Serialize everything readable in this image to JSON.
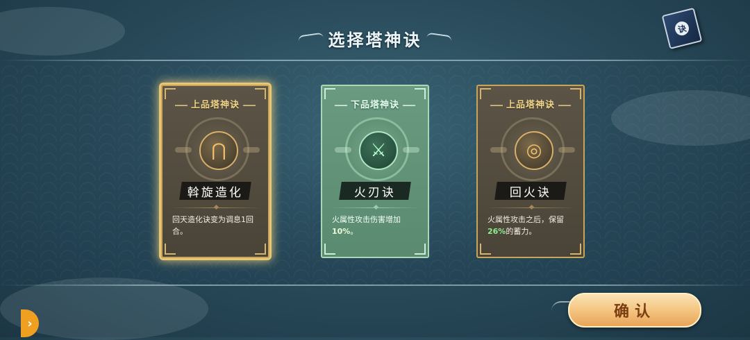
{
  "header": {
    "title": "选择塔神诀"
  },
  "book_button": {
    "glyph": "诀",
    "icon": "skill-book-icon"
  },
  "cards": [
    {
      "grade": "上品塔神诀",
      "name": "斡旋造化",
      "desc": "回天造化诀变为调息1回合。",
      "highlight": "",
      "desc_after": "",
      "icon": "rune-arch-icon",
      "glyph": "⋂",
      "theme": "brown",
      "selected": true
    },
    {
      "grade": "下品塔神诀",
      "name": "火刃诀",
      "desc": "火属性攻击伤害增加",
      "highlight": "10%",
      "desc_after": "。",
      "icon": "blade-icon",
      "glyph": "⚔",
      "theme": "green",
      "selected": false
    },
    {
      "grade": "上品塔神诀",
      "name": "回火诀",
      "desc": "火属性攻击之后，保留",
      "highlight": "26%",
      "desc_after": "的蓄力。",
      "icon": "spiral-flame-icon",
      "glyph": "◎",
      "theme": "brown",
      "selected": false
    }
  ],
  "confirm_button": {
    "label": "确认"
  },
  "side_tab": {
    "glyph": "›",
    "icon": "expand-arrow-icon"
  },
  "colors": {
    "accent_gold": "#c9a55a",
    "accent_green": "#a8d8b8",
    "highlight_text": "#8df08a",
    "button_orange": "#f3c27c"
  }
}
